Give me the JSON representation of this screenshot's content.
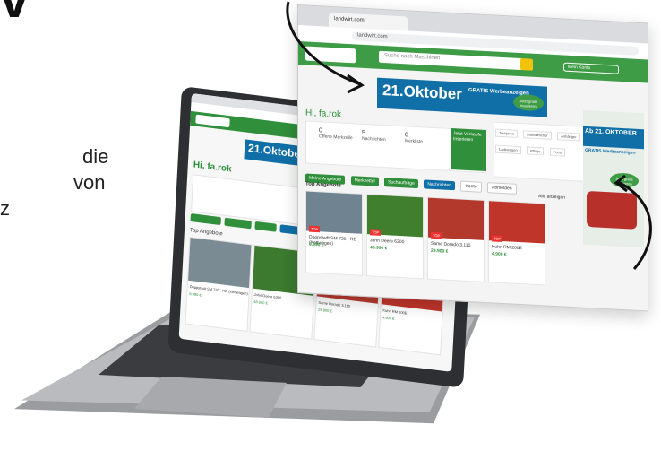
{
  "headline": "v",
  "side_text": [
    "die",
    "von",
    "z"
  ],
  "laptop": {
    "banner_date": "21.Oktober",
    "greeting": "Hi, fa.rok",
    "section_title": "Top Angebote",
    "cards": [
      {
        "title": "Doppstadt SM 720 - RD (Kettwagen)",
        "price": "8.990 €"
      },
      {
        "title": "John Deere 6300",
        "price": "48.990 €"
      },
      {
        "title": "Same Dorado 3.110",
        "price": "29.900 €"
      },
      {
        "title": "Kuhn RM 200E",
        "price": "4.900 €"
      }
    ]
  },
  "window": {
    "tab_title": "landwirt.com",
    "url": "landwirt.com",
    "search_placeholder": "Suche nach Maschinen",
    "user_label": "Mein Konto",
    "banner": {
      "date": "21.Oktober",
      "subtitle": "GRATIS Werbeanzeigen",
      "cta": "Jetzt gratis inserieren"
    },
    "greeting": "Hi, fa.rok",
    "stats": [
      {
        "num": "0",
        "label": "Offene Merkzeile"
      },
      {
        "num": "5",
        "label": "Nachrichten"
      },
      {
        "num": "0",
        "label": "Merkliste"
      }
    ],
    "green_box": "Jetzt Verkaufe Inserieren",
    "chips": [
      "Meine Angebote",
      "Merkzettel",
      "Suchaufträge",
      "Nachrichten",
      "Konto",
      "Abmelden"
    ],
    "tags": [
      "Traktoren",
      "Mähdrescher",
      "Anhänger",
      "Ladewagen",
      "Pflüge",
      "Forst"
    ],
    "section_title": "Top Angebote",
    "all_label": "Alle anzeigen",
    "cards": [
      {
        "title": "Doppstadt SM 720 - RD (Kettwagen)",
        "price": "8.990 €",
        "badge": "TOP"
      },
      {
        "title": "John Deere 6300",
        "price": "48.990 €",
        "badge": "TOP"
      },
      {
        "title": "Same Dorado 3.110",
        "price": "29.900 €",
        "badge": "TOP"
      },
      {
        "title": "Kuhn RM 200E",
        "price": "4.900 €",
        "badge": "TOP"
      }
    ],
    "ad": {
      "title": "Ab 21. OKTOBER",
      "subtitle": "GRATIS Werbeanzeigen",
      "cta": "Jetzt gratis inserieren"
    }
  },
  "colors": {
    "brand_green": "#2f8f3a",
    "banner_blue": "#0f6fa6",
    "accent_yellow": "#f1c30c"
  }
}
